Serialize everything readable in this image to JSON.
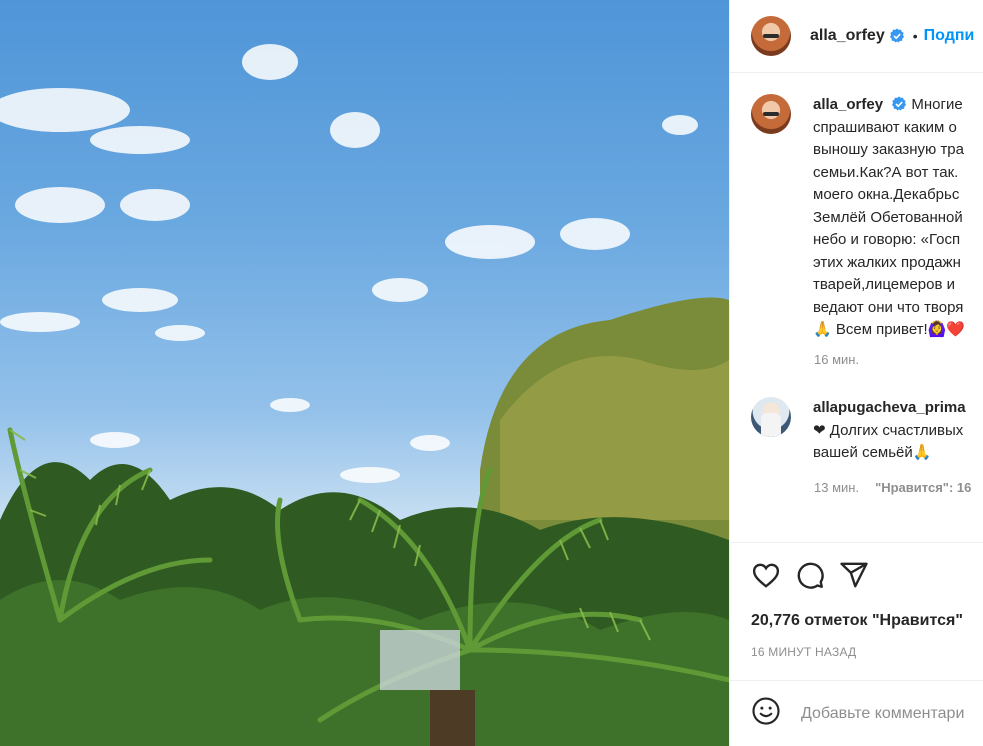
{
  "post": {
    "image_alt": "Sky, clouds and palm trees",
    "username": "alla_orfey",
    "follow_label": "Подпи",
    "separator": "•",
    "caption_lines": [
      "Многие",
      "спрашивают каким о",
      "выношу заказную тра",
      "семьи.Как?А вот так.",
      "моего окна.Декабрьс",
      "Землёй Обетованной",
      "небо и говорю: «Госп",
      "этих жалких продажн",
      "тварей,лицемеров и",
      "ведают они что творя",
      "🙏 Всем привет!🙆‍♀️❤️"
    ],
    "caption_time": "16 мин."
  },
  "comment": {
    "username": "allapugacheva_prima",
    "lines": [
      "❤ Долгих счастливых",
      "вашей семьёй🙏"
    ],
    "time": "13 мин.",
    "likes": "\"Нравится\": 16"
  },
  "actions": {
    "likes_text": "20,776 отметок \"Нравится\"",
    "posted": "16 МИНУТ НАЗАД",
    "comment_placeholder": "Добавьте комментари"
  },
  "colors": {
    "accent": "#0095f6",
    "text": "#262626",
    "muted": "#8e8e8e",
    "border": "#efefef"
  },
  "icons": [
    "verified-badge-icon",
    "heart-icon",
    "comment-icon",
    "share-icon",
    "emoji-icon"
  ]
}
